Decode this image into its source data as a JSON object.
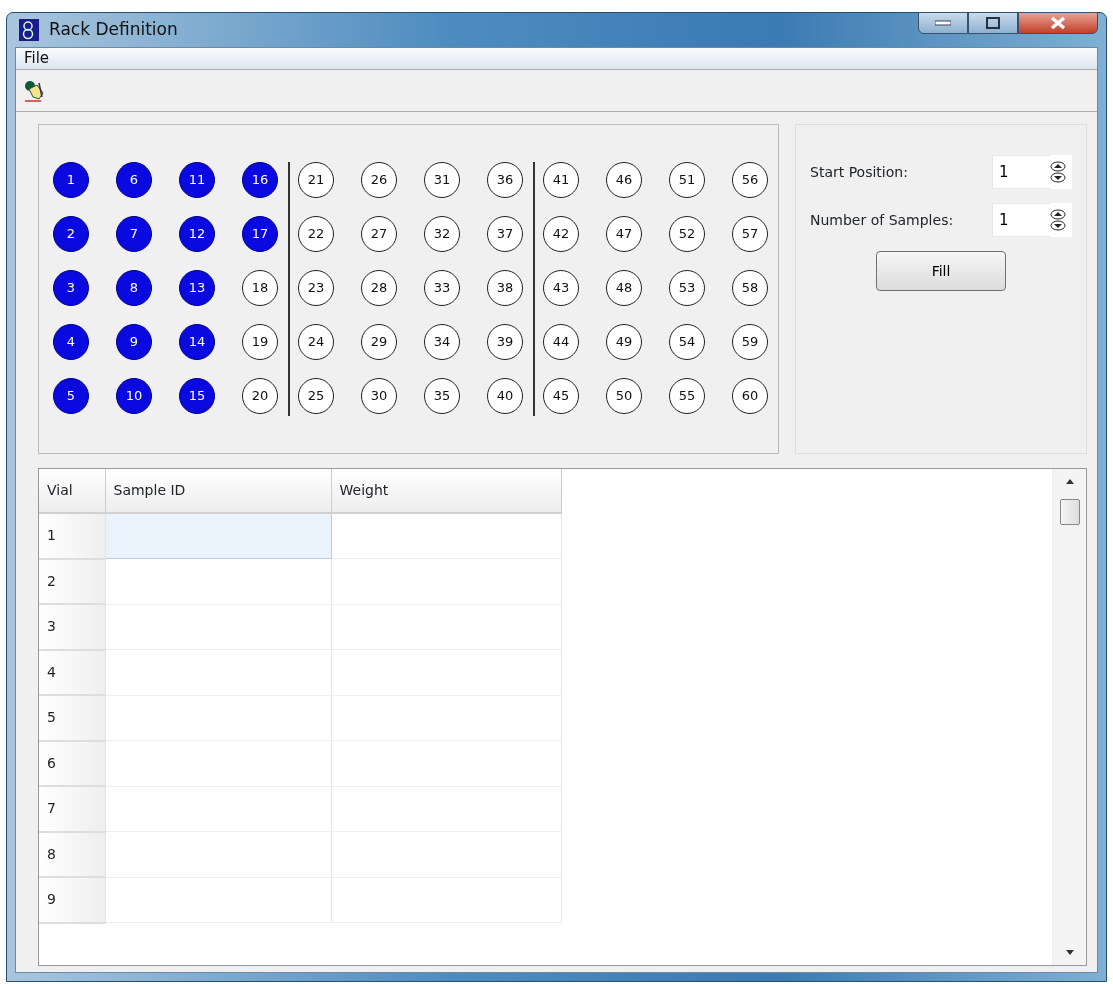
{
  "window": {
    "title": "Rack Definition"
  },
  "menu": [
    {
      "label": "File"
    }
  ],
  "rack": {
    "groups": [
      {
        "vials": [
          {
            "label": "1",
            "filled": true
          },
          {
            "label": "2",
            "filled": true
          },
          {
            "label": "3",
            "filled": true
          },
          {
            "label": "4",
            "filled": true
          },
          {
            "label": "5",
            "filled": true
          },
          {
            "label": "6",
            "filled": true
          },
          {
            "label": "7",
            "filled": true
          },
          {
            "label": "8",
            "filled": true
          },
          {
            "label": "9",
            "filled": true
          },
          {
            "label": "10",
            "filled": true
          },
          {
            "label": "11",
            "filled": true
          },
          {
            "label": "12",
            "filled": true
          },
          {
            "label": "13",
            "filled": true
          },
          {
            "label": "14",
            "filled": true
          },
          {
            "label": "15",
            "filled": true
          },
          {
            "label": "16",
            "filled": true
          },
          {
            "label": "17",
            "filled": true
          },
          {
            "label": "18",
            "filled": false
          },
          {
            "label": "19",
            "filled": false
          },
          {
            "label": "20",
            "filled": false
          }
        ]
      },
      {
        "vials": [
          {
            "label": "21",
            "filled": false
          },
          {
            "label": "22",
            "filled": false
          },
          {
            "label": "23",
            "filled": false
          },
          {
            "label": "24",
            "filled": false
          },
          {
            "label": "25",
            "filled": false
          },
          {
            "label": "26",
            "filled": false
          },
          {
            "label": "27",
            "filled": false
          },
          {
            "label": "28",
            "filled": false
          },
          {
            "label": "29",
            "filled": false
          },
          {
            "label": "30",
            "filled": false
          },
          {
            "label": "31",
            "filled": false
          },
          {
            "label": "32",
            "filled": false
          },
          {
            "label": "33",
            "filled": false
          },
          {
            "label": "34",
            "filled": false
          },
          {
            "label": "35",
            "filled": false
          },
          {
            "label": "36",
            "filled": false
          },
          {
            "label": "37",
            "filled": false
          },
          {
            "label": "38",
            "filled": false
          },
          {
            "label": "39",
            "filled": false
          },
          {
            "label": "40",
            "filled": false
          }
        ]
      },
      {
        "vials": [
          {
            "label": "41",
            "filled": false
          },
          {
            "label": "42",
            "filled": false
          },
          {
            "label": "43",
            "filled": false
          },
          {
            "label": "44",
            "filled": false
          },
          {
            "label": "45",
            "filled": false
          },
          {
            "label": "46",
            "filled": false
          },
          {
            "label": "47",
            "filled": false
          },
          {
            "label": "48",
            "filled": false
          },
          {
            "label": "49",
            "filled": false
          },
          {
            "label": "50",
            "filled": false
          },
          {
            "label": "51",
            "filled": false
          },
          {
            "label": "52",
            "filled": false
          },
          {
            "label": "53",
            "filled": false
          },
          {
            "label": "54",
            "filled": false
          },
          {
            "label": "55",
            "filled": false
          },
          {
            "label": "56",
            "filled": false
          },
          {
            "label": "57",
            "filled": false
          },
          {
            "label": "58",
            "filled": false
          },
          {
            "label": "59",
            "filled": false
          },
          {
            "label": "60",
            "filled": false
          }
        ]
      }
    ]
  },
  "fill_panel": {
    "fields": [
      {
        "label": "Start Position:",
        "value": "1"
      },
      {
        "label": "Number of Samples:",
        "value": "1"
      }
    ],
    "button": "Fill"
  },
  "table": {
    "columns": [
      "Vial",
      "Sample ID",
      "Weight"
    ],
    "rows": [
      {
        "vial": "1",
        "selected": true
      },
      {
        "vial": "2",
        "selected": false
      },
      {
        "vial": "3",
        "selected": false
      },
      {
        "vial": "4",
        "selected": false
      },
      {
        "vial": "5",
        "selected": false
      },
      {
        "vial": "6",
        "selected": false
      },
      {
        "vial": "7",
        "selected": false
      },
      {
        "vial": "8",
        "selected": false
      },
      {
        "vial": "9",
        "selected": false
      }
    ]
  }
}
